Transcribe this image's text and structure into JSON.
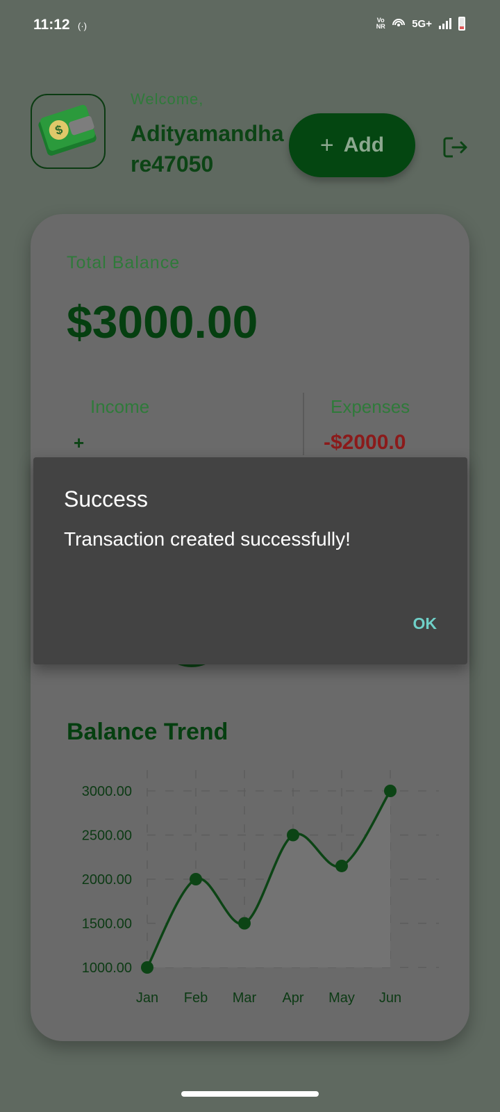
{
  "status_bar": {
    "time": "11:12",
    "hotspot_glyph": "(·)",
    "vonr": "Vo NR",
    "network": "5G+",
    "signal_level": 0.75,
    "battery_level": 0.15
  },
  "header": {
    "welcome": "Welcome,",
    "username": "Adityamandhare47050",
    "add_button_label": "Add",
    "add_icon": "plus-icon",
    "logout_icon": "logout-icon",
    "avatar_icon": "wallet-dollar-icon"
  },
  "balance": {
    "total_label": "Total Balance",
    "total_value": "$3000.00",
    "income_label": "Income",
    "income_value": "+",
    "expense_label": "Expenses",
    "expense_value": "-$2000.0"
  },
  "trend": {
    "title": "Balance Trend"
  },
  "chart_data": {
    "type": "line",
    "title": "Balance Trend",
    "x": [
      "Jan",
      "Feb",
      "Mar",
      "Apr",
      "May",
      "Jun"
    ],
    "series": [
      {
        "values": [
          1000,
          2000,
          1500,
          2500,
          2150,
          3000
        ]
      }
    ],
    "y_ticks": [
      "3000.00",
      "2500.00",
      "2000.00",
      "1500.00",
      "1000.00"
    ],
    "ylim": [
      1000,
      3000
    ],
    "grid": true,
    "line_color": "#0c4415",
    "fill_color": "#737373"
  },
  "dialog": {
    "title": "Success",
    "message": "Transaction created successfully!",
    "ok_label": "OK"
  }
}
